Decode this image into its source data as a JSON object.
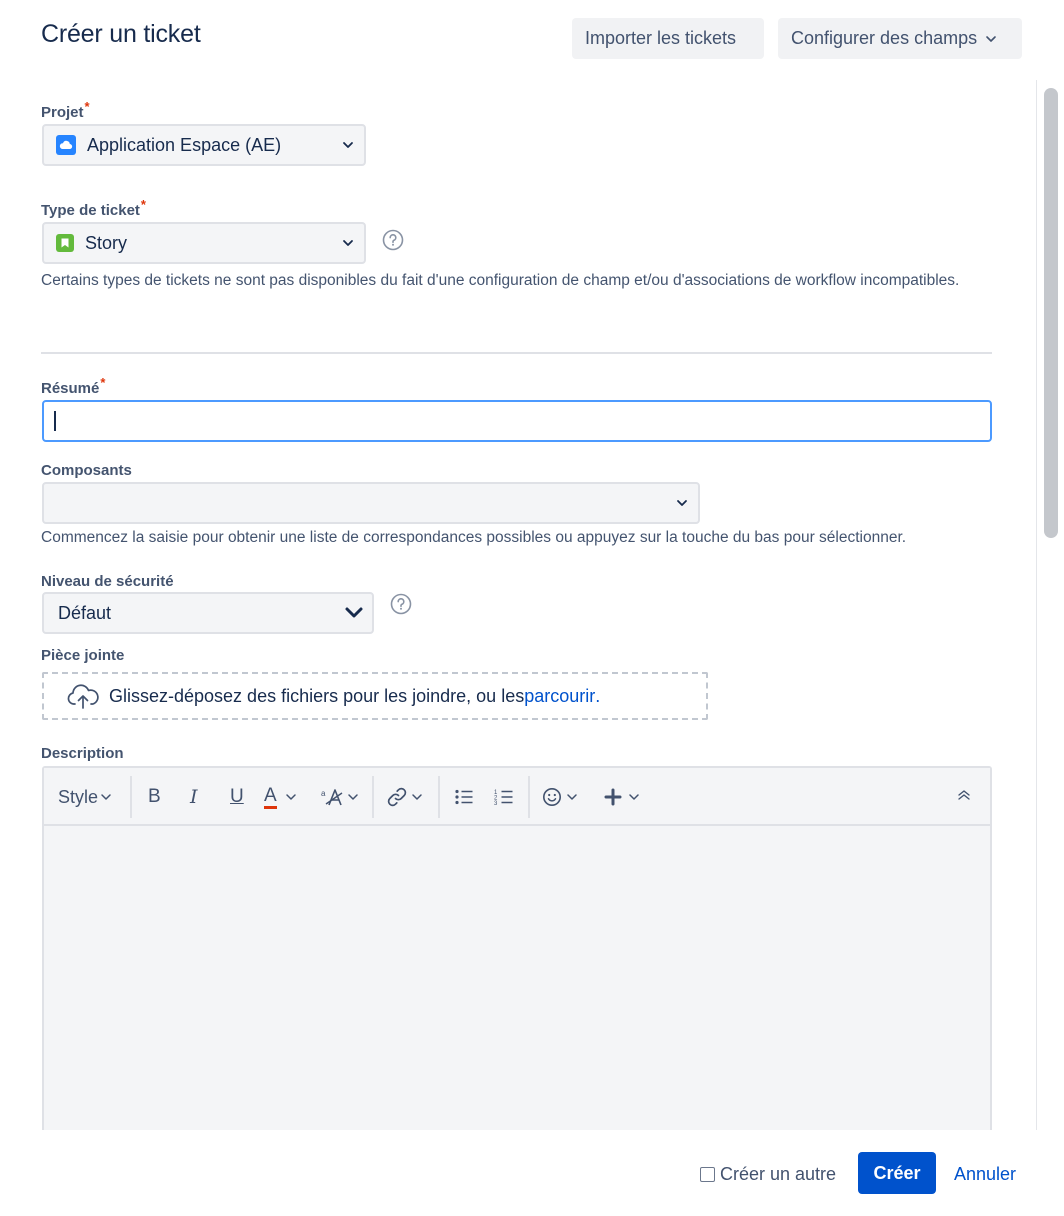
{
  "dialog": {
    "title": "Créer un ticket",
    "import_label": "Importer les tickets",
    "configure_label": "Configurer des champs"
  },
  "fields": {
    "project": {
      "label": "Projet",
      "required_mark": "*",
      "value": "Application Espace (AE)",
      "icon": "cloud-project-icon"
    },
    "issue_type": {
      "label": "Type de ticket",
      "required_mark": "*",
      "value": "Story",
      "icon": "story-icon",
      "hint": "Certains types de tickets ne sont pas disponibles du fait d'une configuration de champ et/ou d'associations de workflow incompatibles."
    },
    "summary": {
      "label": "Résumé",
      "required_mark": "*",
      "value": ""
    },
    "components": {
      "label": "Composants",
      "value": "",
      "hint": "Commencez la saisie pour obtenir une liste de correspondances possibles ou appuyez sur la touche du bas pour sélectionner."
    },
    "security": {
      "label": "Niveau de sécurité",
      "value": "Défaut"
    },
    "attachment": {
      "label": "Pièce jointe",
      "drop_text": "Glissez-déposez des fichiers pour les joindre, ou les ",
      "browse_link": "parcourir",
      "drop_suffix": "."
    },
    "description": {
      "label": "Description",
      "style_label": "Style",
      "bold": "B",
      "italic": "I",
      "underline": "U",
      "color": "A",
      "value": ""
    }
  },
  "footer": {
    "create_another_label": "Créer un autre",
    "create_label": "Créer",
    "cancel_label": "Annuler"
  },
  "colors": {
    "primary": "#0052cc",
    "required": "#de350b",
    "focus": "#4c9aff",
    "story": "#63ba3c",
    "project": "#2684ff"
  }
}
